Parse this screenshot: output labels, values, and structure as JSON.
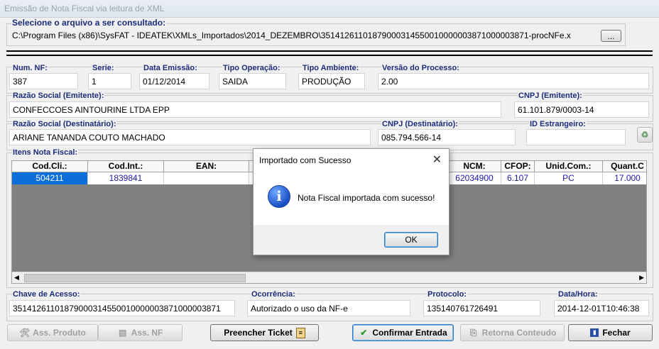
{
  "window": {
    "title": "Emissão de Nota Fiscal via leitura de XML"
  },
  "file": {
    "label": "Selecione o arquivo a ser consultado:",
    "path": "C:\\Program Files (x86)\\SysFAT - IDEATEK\\XMLs_Importados\\2014_DEZEMBRO\\35141261101879000314550010000003871000003871-procNFe.x",
    "browse": "..."
  },
  "nf": {
    "num_label": "Num. NF:",
    "num": "387",
    "serie_label": "Serie:",
    "serie": "1",
    "data_label": "Data Emissão:",
    "data": "01/12/2014",
    "tipo_op_label": "Tipo Operação:",
    "tipo_op": "SAIDA",
    "tipo_amb_label": "Tipo Ambiente:",
    "tipo_amb": "PRODUÇÃO",
    "versao_label": "Versão do Processo:",
    "versao": "2.00"
  },
  "emitente": {
    "razao_label": "Razão Social (Emitente):",
    "razao": "CONFECCOES AINTOURINE  LTDA EPP",
    "cnpj_label": "CNPJ (Emitente):",
    "cnpj": "61.101.879/0003-14"
  },
  "destinatario": {
    "razao_label": "Razão Social (Destinatário):",
    "razao": "ARIANE TANANDA COUTO MACHADO",
    "cnpj_label": "CNPJ (Destinatário):",
    "cnpj": "085.794.566-14",
    "id_label": "ID Estrangeiro:",
    "id": ""
  },
  "items": {
    "label": "Itens Nota Fiscal:",
    "columns": [
      "Cod.Cli.:",
      "Cod.Int.:",
      "EAN:",
      "",
      "",
      "NCM:",
      "CFOP:",
      "Unid.Com.:",
      "Quant.C"
    ],
    "rows": [
      [
        "504211",
        "1839841",
        "",
        "",
        "",
        "62034900",
        "6.107",
        "PC",
        "17.000"
      ]
    ]
  },
  "footer": {
    "chave_label": "Chave de Acesso:",
    "chave": "35141261101879000314550010000003871000003871",
    "ocorrencia_label": "Ocorrência:",
    "ocorrencia": "Autorizado o uso da NF-e",
    "protocolo_label": "Protocolo:",
    "protocolo": "135140761726491",
    "datahora_label": "Data/Hora:",
    "datahora": "2014-12-01T10:46:38"
  },
  "buttons": {
    "ass_produto": "Ass. Produto",
    "ass_nf": "Ass. NF",
    "preencher": "Preencher Ticket",
    "confirmar": "Confirmar Entrada",
    "retorna": "Retorna Conteudo",
    "fechar": "Fechar"
  },
  "dialog": {
    "title": "Importado com Sucesso",
    "message": "Nota Fiscal importada com sucesso!",
    "ok": "OK",
    "close": "✕",
    "icon": "info-icon"
  }
}
